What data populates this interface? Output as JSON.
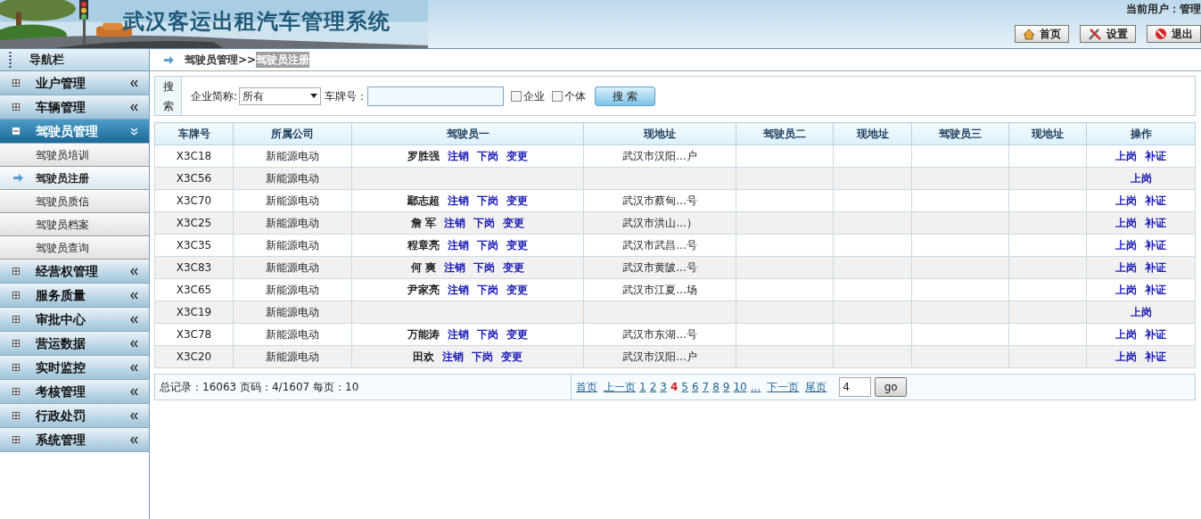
{
  "header": {
    "title": "武汉客运出租汽车管理系统",
    "current_user": "当前用户：管理",
    "buttons": [
      {
        "kind": "home",
        "label": "首页"
      },
      {
        "kind": "settings",
        "label": "设置"
      },
      {
        "kind": "logout",
        "label": "退出"
      }
    ]
  },
  "sidebar": {
    "title": "导航栏",
    "groups": [
      {
        "label": "业户管理",
        "expanded": false
      },
      {
        "label": "车辆管理",
        "expanded": false
      },
      {
        "label": "驾驶员管理",
        "expanded": true,
        "children": [
          {
            "label": "驾驶员培训",
            "selected": false
          },
          {
            "label": "驾驶员注册",
            "selected": true
          },
          {
            "label": "驾驶员质信",
            "selected": false
          },
          {
            "label": "驾驶员档案",
            "selected": false
          },
          {
            "label": "驾驶员查询",
            "selected": false
          }
        ]
      },
      {
        "label": "经营权管理",
        "expanded": false
      },
      {
        "label": "服务质量",
        "expanded": false
      },
      {
        "label": "审批中心",
        "expanded": false
      },
      {
        "label": "营运数据",
        "expanded": false
      },
      {
        "label": "实时监控",
        "expanded": false
      },
      {
        "label": "考核管理",
        "expanded": false
      },
      {
        "label": "行政处罚",
        "expanded": false
      },
      {
        "label": "系统管理",
        "expanded": false
      }
    ]
  },
  "breadcrumb": {
    "parent": "驾驶员管理>>",
    "current": "驾驶员注册"
  },
  "search": {
    "label": "搜索",
    "company_label": "企业简称:",
    "company_value": "所有",
    "plate_label": "车牌号：",
    "checkboxes": [
      {
        "label": "企业",
        "checked": false
      },
      {
        "label": "个体",
        "checked": false
      }
    ],
    "button": "搜 索"
  },
  "table": {
    "columns": [
      "车牌号",
      "所属公司",
      "驾驶员一",
      "现地址",
      "驾驶员二",
      "现地址",
      "驾驶员三",
      "现地址",
      "操作"
    ],
    "rows": [
      {
        "plate": "X3C18",
        "company": "新能源电动",
        "driver": "罗胜强",
        "actions": [
          "注销",
          "下岗",
          "变更"
        ],
        "address": "武汉市汉阳...户",
        "ops": [
          "上岗",
          "补证"
        ]
      },
      {
        "plate": "X3C56",
        "company": "新能源电动",
        "ops": [
          "上岗"
        ]
      },
      {
        "plate": "X3C70",
        "company": "新能源电动",
        "driver": "鄢志超",
        "actions": [
          "注销",
          "下岗",
          "变更"
        ],
        "address": "武汉市蔡甸...号",
        "ops": [
          "上岗",
          "补证"
        ]
      },
      {
        "plate": "X3C25",
        "company": "新能源电动",
        "driver": "詹 军",
        "actions": [
          "注销",
          "下岗",
          "变更"
        ],
        "address": "武汉市洪山...）",
        "ops": [
          "上岗",
          "补证"
        ]
      },
      {
        "plate": "X3C35",
        "company": "新能源电动",
        "driver": "程章亮",
        "actions": [
          "注销",
          "下岗",
          "变更"
        ],
        "address": "武汉市武昌...号",
        "ops": [
          "上岗",
          "补证"
        ]
      },
      {
        "plate": "X3C83",
        "company": "新能源电动",
        "driver": "何 爽",
        "actions": [
          "注销",
          "下岗",
          "变更"
        ],
        "address": "武汉市黄陂...号",
        "ops": [
          "上岗",
          "补证"
        ]
      },
      {
        "plate": "X3C65",
        "company": "新能源电动",
        "driver": "尹家亮",
        "actions": [
          "注销",
          "下岗",
          "变更"
        ],
        "address": "武汉市江夏...场",
        "ops": [
          "上岗",
          "补证"
        ]
      },
      {
        "plate": "X3C19",
        "company": "新能源电动",
        "ops": [
          "上岗"
        ]
      },
      {
        "plate": "X3C78",
        "company": "新能源电动",
        "driver": "万能涛",
        "actions": [
          "注销",
          "下岗",
          "变更"
        ],
        "address": "武汉市东湖...号",
        "ops": [
          "上岗",
          "补证"
        ]
      },
      {
        "plate": "X3C20",
        "company": "新能源电动",
        "driver": "田欢",
        "actions": [
          "注销",
          "下岗",
          "变更"
        ],
        "address": "武汉市汉阳...户",
        "ops": [
          "上岗",
          "补证"
        ]
      }
    ]
  },
  "pager": {
    "summary": "总记录：16063 页码：4/1607 每页：10",
    "first": "首页",
    "prev": "上一页",
    "pages": [
      {
        "label": "1",
        "selected": false
      },
      {
        "label": "2",
        "selected": false
      },
      {
        "label": "3",
        "selected": false
      },
      {
        "label": "4",
        "selected": true
      },
      {
        "label": "5",
        "selected": false
      },
      {
        "label": "6",
        "selected": false
      },
      {
        "label": "7",
        "selected": false
      },
      {
        "label": "8",
        "selected": false
      },
      {
        "label": "9",
        "selected": false
      },
      {
        "label": "10",
        "selected": false
      }
    ],
    "more": "...",
    "next": "下一页",
    "last": "尾页",
    "input_value": "4",
    "go": "go"
  }
}
